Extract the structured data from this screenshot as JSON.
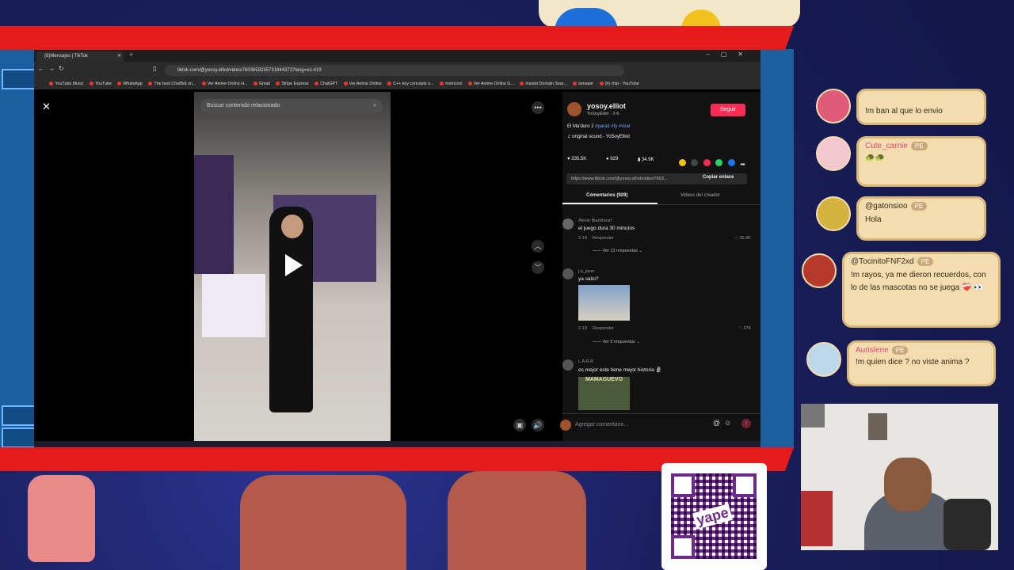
{
  "browser": {
    "tab_title": "(8)Mensajes | TikTok",
    "url": "tiktok.com/@yosoy.elliot/video/7603853235731844372?lang=es-419",
    "bookmarks": [
      "YouTube Music",
      "YouTube",
      "WhatsApp",
      "The best ChatBot on...",
      "Ver Anime Online H...",
      "Gmail",
      "Stripe Express",
      "ChatGPT",
      "Ver Anime Online",
      "C++ key concepts o...",
      "metricool",
      "Ver Anime Online G...",
      "Instant Domain Sear...",
      "lamasor",
      "(9) chip - YouTube"
    ]
  },
  "video": {
    "search_placeholder": "Buscar contenido relacionado"
  },
  "panel": {
    "username": "yosoy.elliot",
    "display_name": "YoSoyElliot · 2-6",
    "follow_label": "Seguir",
    "caption_text": "El Ma'duro 2",
    "caption_tags": "#parati #fy #viral",
    "sound": "original sound - YoSoyElliot",
    "likes": "335.5K",
    "comments_count": "929",
    "saves": "34.9K",
    "link": "https://www.tiktok.com/@yosoy.elliot/video/7603...",
    "copy_link": "Copiar enlace",
    "tab_comments": "Comentarios (929)",
    "tab_creator": "Videos del creador",
    "comments": [
      {
        "user": "Alexie Blackheart",
        "text": "el juego dura 30 minutos",
        "date": "2-19",
        "reply": "Responder",
        "likes": "20.3K",
        "replies": "Ver 13 respuestas"
      },
      {
        "user": "j.p_jazer",
        "text": "ya salio?",
        "date": "2-19",
        "reply": "Responder",
        "likes": "27K",
        "replies": "Ver 5 respuestas"
      },
      {
        "user": "L.A.R.R",
        "text": "es mejor este tiene mejor historia 🗿",
        "image_text": "MAMAGUEVO"
      }
    ],
    "comment_placeholder": "Agregar comentario..."
  },
  "chat": [
    {
      "user": "",
      "text": "!m ban al que lo envio"
    },
    {
      "user": "Cute_carnie",
      "badge": "PE",
      "text": "🐢🐢"
    },
    {
      "user": "@gatonsioo",
      "badge": "PE",
      "text": "Hola"
    },
    {
      "user": "@TocinitoFNF2xd",
      "badge": "PE",
      "text": "!m rayos, ya me dieron recuerdos, con lo de las mascotas no se juega ❤️‍🩹 👀"
    },
    {
      "user": "Aurislene",
      "badge": "PE",
      "text": "!m quien dice ? no viste anima ?"
    }
  ],
  "qr": {
    "brand": "yape"
  },
  "colors": {
    "accent_red": "#e51b1b",
    "tiktok_pink": "#fe2c55",
    "bubble": "#f3dcae",
    "background": "#1b2260"
  }
}
